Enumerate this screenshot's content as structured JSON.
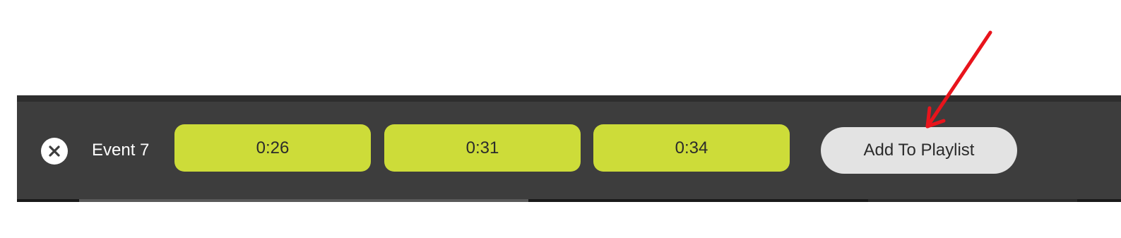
{
  "event_bar": {
    "event_label": "Event 7",
    "close_icon": "close-icon",
    "timestamps": [
      "0:26",
      "0:31",
      "0:34"
    ],
    "add_to_playlist_label": "Add To Playlist"
  },
  "annotation": {
    "arrow_color": "#e8141c"
  },
  "colors": {
    "bar_background": "#3d3d3d",
    "timestamp_button": "#cddc39",
    "add_button": "#e3e3e3"
  }
}
